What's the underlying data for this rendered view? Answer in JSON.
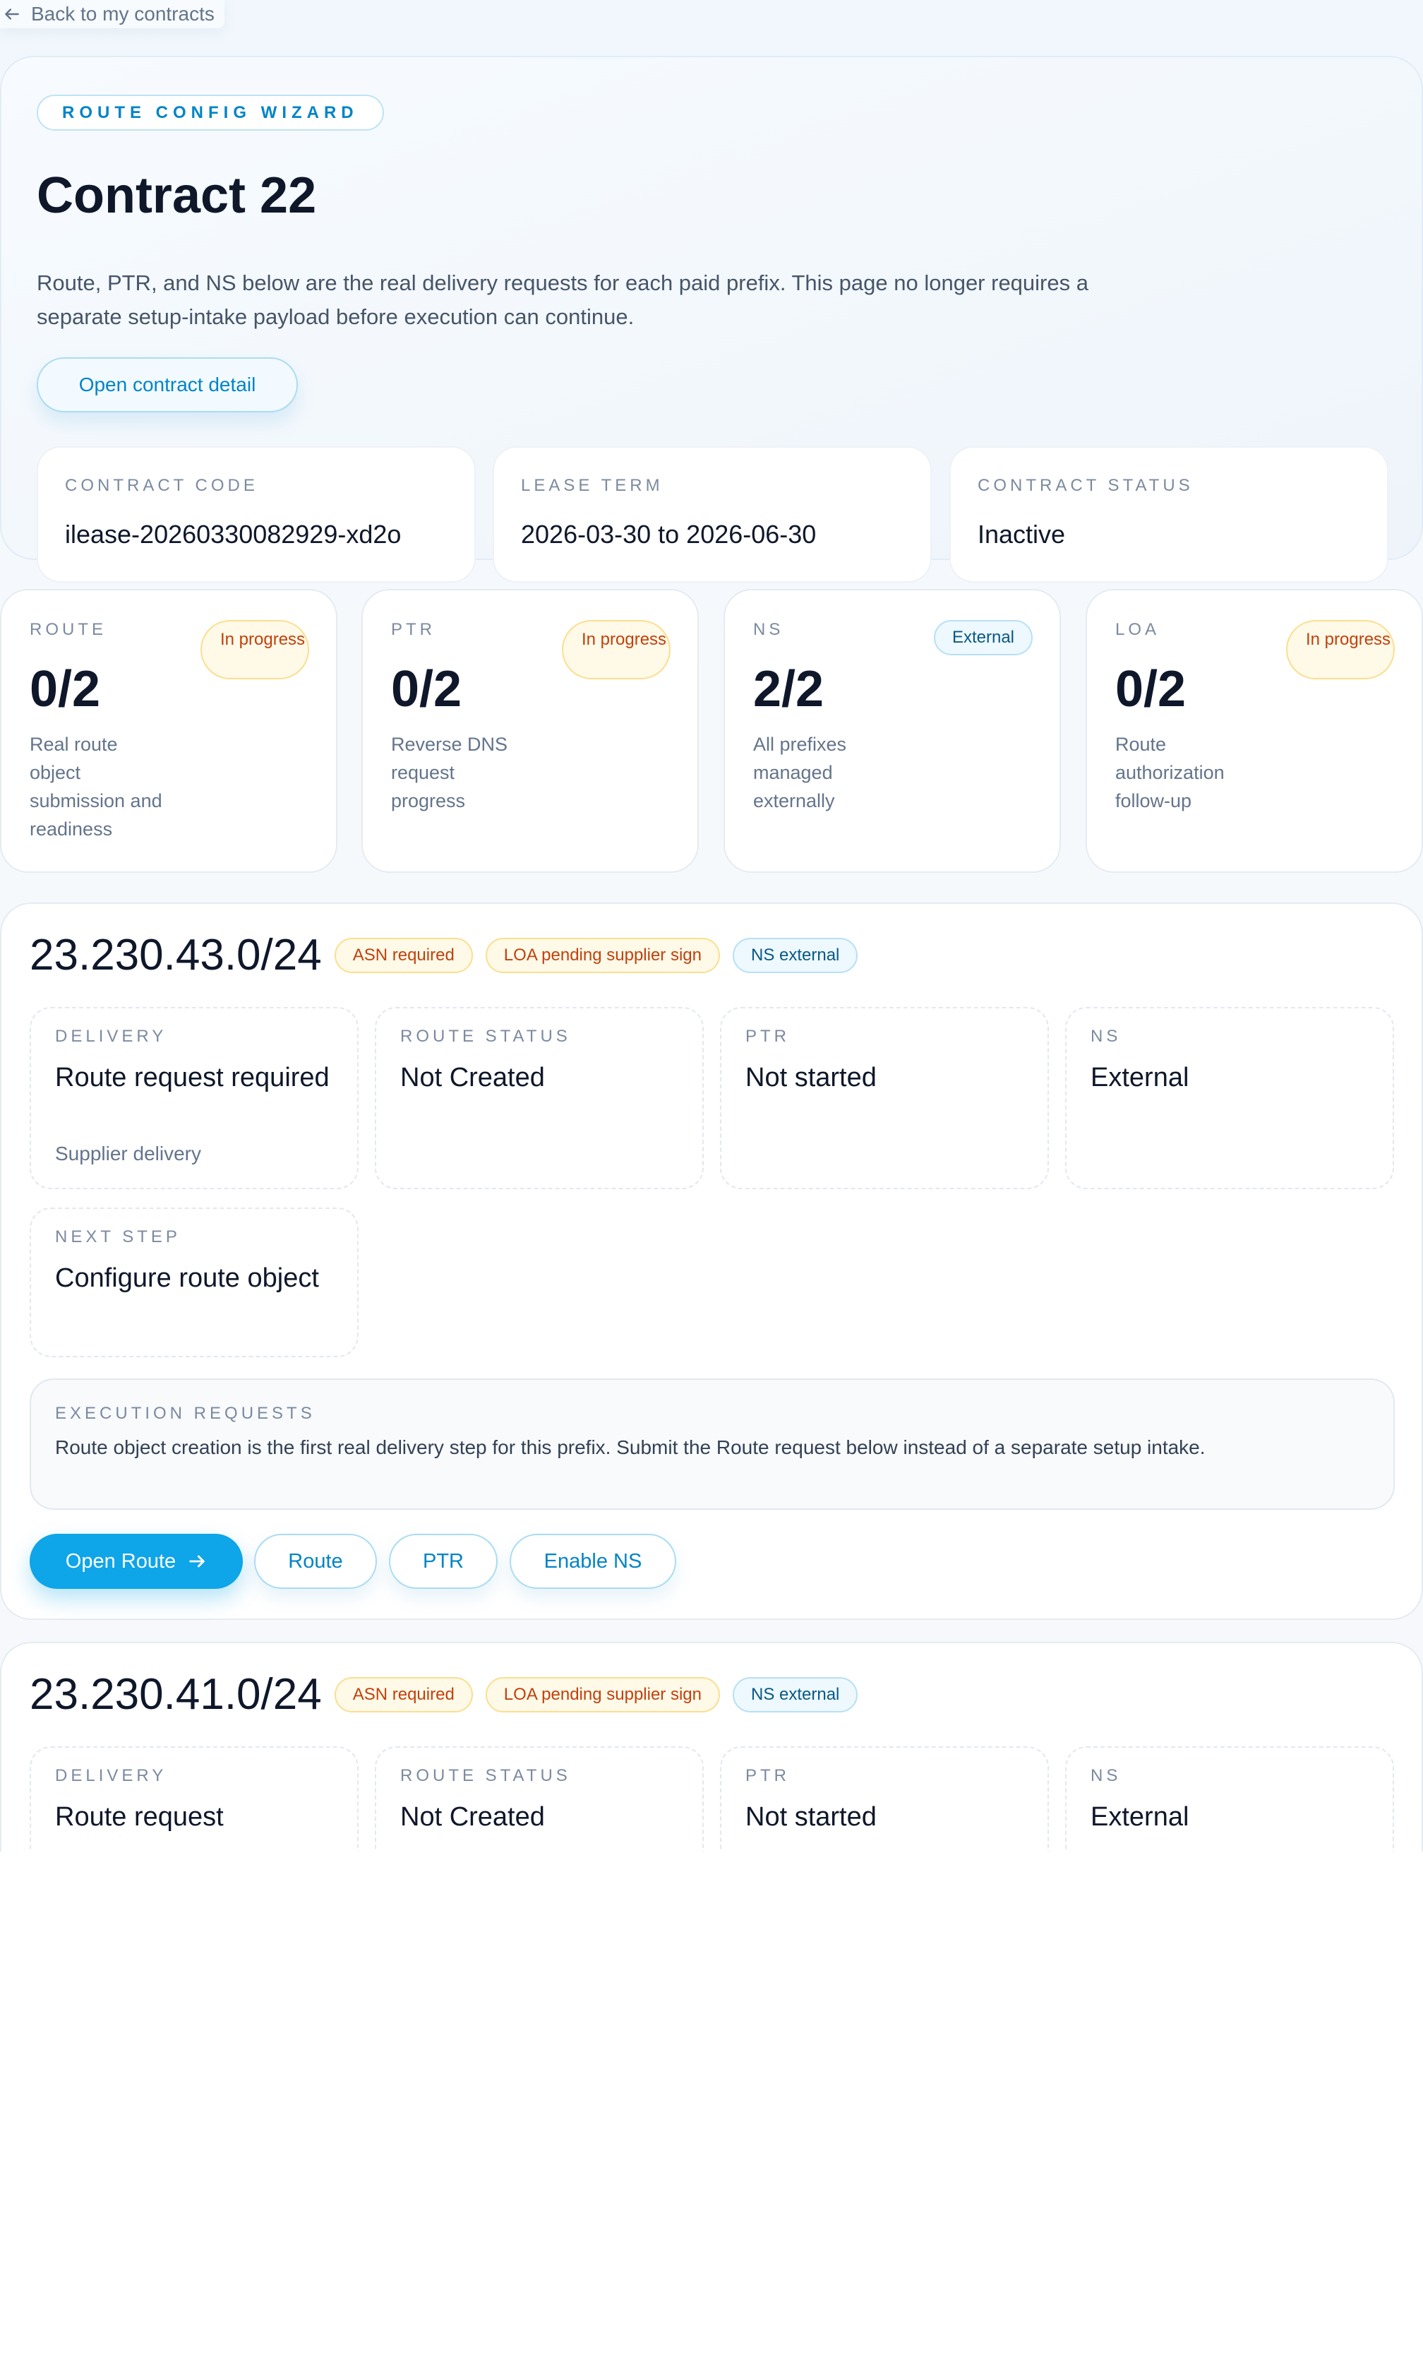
{
  "back": {
    "label": "Back to my contracts"
  },
  "hero": {
    "pill": "ROUTE CONFIG WIZARD",
    "title": "Contract 22",
    "description": "Route, PTR, and NS below are the real delivery requests for each paid prefix. This page no longer requires a separate setup-intake payload before execution can continue.",
    "open_detail": "Open contract detail",
    "cards": [
      {
        "label": "CONTRACT CODE",
        "value": "ilease-20260330082929-xd2o"
      },
      {
        "label": "LEASE TERM",
        "value": "2026-03-30 to 2026-06-30"
      },
      {
        "label": "CONTRACT STATUS",
        "value": "Inactive"
      }
    ]
  },
  "stats": [
    {
      "label": "ROUTE",
      "value": "0/2",
      "badge": "In progress",
      "sub": "Real route object submission and readiness"
    },
    {
      "label": "PTR",
      "value": "0/2",
      "badge": "In progress",
      "sub": "Reverse DNS request progress"
    },
    {
      "label": "NS",
      "value": "2/2",
      "badge": "External",
      "sub": "All prefixes managed externally"
    },
    {
      "label": "LOA",
      "value": "0/2",
      "badge": "In progress",
      "sub": "Route authorization follow-up"
    }
  ],
  "prefixes": [
    {
      "prefix": "23.230.43.0/24",
      "tags": [
        "ASN required",
        "LOA pending supplier sign",
        "NS external"
      ],
      "fields": [
        {
          "label": "DELIVERY",
          "value": "Route request required",
          "sub": "Supplier delivery"
        },
        {
          "label": "ROUTE STATUS",
          "value": "Not Created"
        },
        {
          "label": "PTR",
          "value": "Not started"
        },
        {
          "label": "NS",
          "value": "External"
        },
        {
          "label": "NEXT STEP",
          "value": "Configure route object"
        }
      ],
      "exec_label": "EXECUTION REQUESTS",
      "exec_text": "Route object creation is the first real delivery step for this prefix. Submit the Route request below instead of a separate setup intake.",
      "buttons": {
        "primary": "Open Route",
        "route": "Route",
        "ptr": "PTR",
        "ns": "Enable NS"
      }
    },
    {
      "prefix": "23.230.41.0/24",
      "tags": [
        "ASN required",
        "LOA pending supplier sign",
        "NS external"
      ],
      "fields": [
        {
          "label": "DELIVERY",
          "value": "Route request"
        },
        {
          "label": "ROUTE STATUS",
          "value": "Not Created"
        },
        {
          "label": "PTR",
          "value": "Not started"
        },
        {
          "label": "NS",
          "value": "External"
        }
      ]
    }
  ],
  "colors": {
    "accent": "#0ea5e9",
    "amber_text": "#c2410c",
    "blue_text": "#075985"
  }
}
